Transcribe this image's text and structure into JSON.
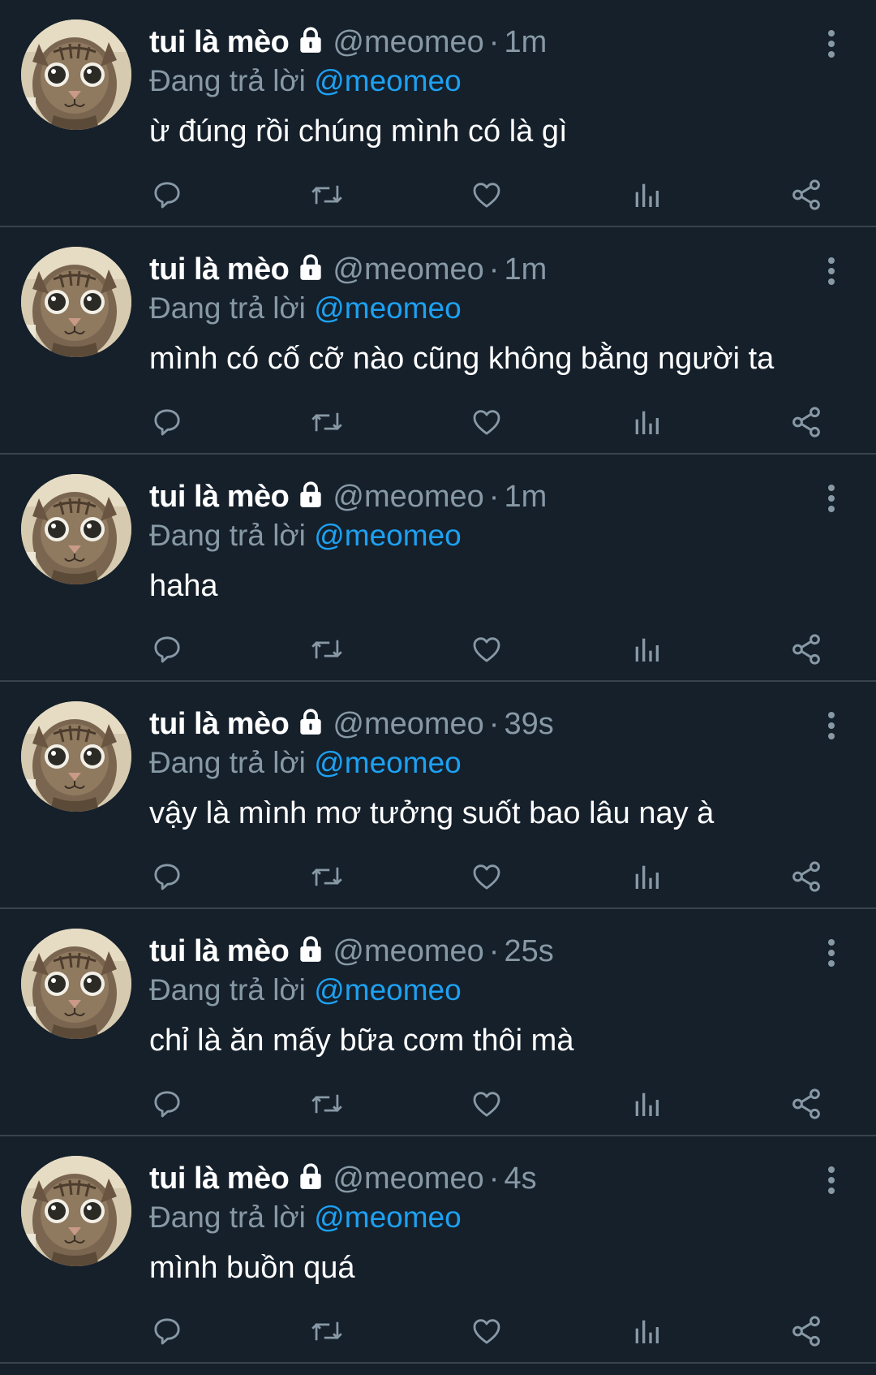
{
  "tweets": [
    {
      "name": "tui là mèo",
      "handle": "@meomeo",
      "separator": "·",
      "time": "1m",
      "replying_label": "Đang trả lời",
      "mention": "@meomeo",
      "text": "ừ đúng rồi chúng mình có là gì"
    },
    {
      "name": "tui là mèo",
      "handle": "@meomeo",
      "separator": "·",
      "time": "1m",
      "replying_label": "Đang trả lời",
      "mention": "@meomeo",
      "text": "mình có cố cỡ nào cũng không bằng người ta"
    },
    {
      "name": "tui là mèo",
      "handle": "@meomeo",
      "separator": "·",
      "time": "1m",
      "replying_label": "Đang trả lời",
      "mention": "@meomeo",
      "text": "haha"
    },
    {
      "name": "tui là mèo",
      "handle": "@meomeo",
      "separator": "·",
      "time": "39s",
      "replying_label": "Đang trả lời",
      "mention": "@meomeo",
      "text": "vậy là mình mơ tưởng suốt bao lâu nay à"
    },
    {
      "name": "tui là mèo",
      "handle": "@meomeo",
      "separator": "·",
      "time": "25s",
      "replying_label": "Đang trả lời",
      "mention": "@meomeo",
      "text": "chỉ là ăn mấy bữa cơm thôi mà"
    },
    {
      "name": "tui là mèo",
      "handle": "@meomeo",
      "separator": "·",
      "time": "4s",
      "replying_label": "Đang trả lời",
      "mention": "@meomeo",
      "text": "mình buồn quá"
    }
  ],
  "icons": {
    "locked": "lock-icon",
    "more": "more-vertical-icon",
    "reply": "reply-icon",
    "retweet": "retweet-icon",
    "like": "heart-icon",
    "stats": "stats-icon",
    "share": "share-icon",
    "avatar": "cat-avatar"
  },
  "colors": {
    "background": "#15202b",
    "divider": "#38444d",
    "text_primary": "#ffffff",
    "text_secondary": "#8899a6",
    "accent": "#1da1f2"
  }
}
